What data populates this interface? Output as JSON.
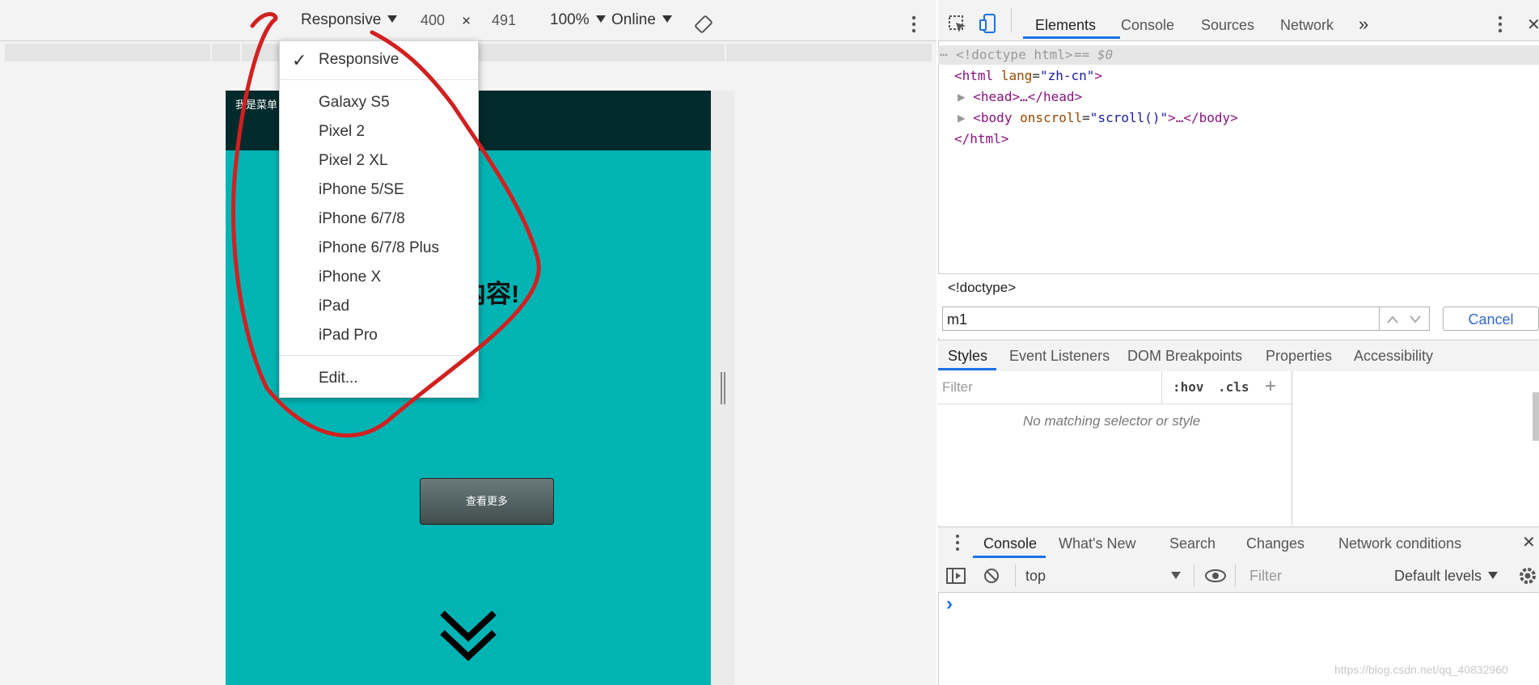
{
  "device_toolbar": {
    "device": "Responsive",
    "width": "400",
    "times": "×",
    "height": "491",
    "zoom": "100%",
    "throttling": "Online"
  },
  "device_menu": {
    "selected": "Responsive",
    "items": [
      "Galaxy S5",
      "Pixel 2",
      "Pixel 2 XL",
      "iPhone 5/SE",
      "iPhone 6/7/8",
      "iPhone 6/7/8 Plus",
      "iPhone X",
      "iPad",
      "iPad Pro"
    ],
    "edit": "Edit..."
  },
  "page_preview": {
    "menu_label": "我是菜单",
    "heading_visible": "内容!",
    "more_button": "查看更多"
  },
  "devtools": {
    "tabs": [
      "Elements",
      "Console",
      "Sources",
      "Network"
    ],
    "more_tabs": "»",
    "active_tab": "Elements",
    "dom": {
      "line1_doctype": "<!doctype html>",
      "line1_ref": " == $0",
      "html_open_tag": "<html",
      "lang_attr": " lang",
      "lang_value": "\"zh-cn\"",
      "html_close_bracket": ">",
      "head": "<head>…</head>",
      "body_open": "<body",
      "onscroll_attr": " onscroll",
      "onscroll_value": "\"scroll()\"",
      "body_rest": ">…</body>",
      "html_close": "</html>"
    },
    "breadcrumb": "<!doctype>",
    "search": {
      "value": "m1",
      "cancel": "Cancel"
    },
    "styles_tabs": [
      "Styles",
      "Event Listeners",
      "DOM Breakpoints",
      "Properties",
      "Accessibility"
    ],
    "styles_filter_placeholder": "Filter",
    "hov": ":hov",
    "cls": ".cls",
    "plus": "+",
    "no_match": "No matching selector or style"
  },
  "drawer": {
    "tabs": [
      "Console",
      "What's New",
      "Search",
      "Changes",
      "Network conditions"
    ],
    "context": "top",
    "filter_placeholder": "Filter",
    "levels": "Default levels",
    "prompt": "›",
    "close": "✕"
  },
  "watermark": "https://blog.csdn.net/qq_40832960",
  "colors": {
    "page_bg": "#00b4b4",
    "page_header": "#002a2c",
    "annotation": "#d22020",
    "active_tab": "#1a73e8"
  }
}
